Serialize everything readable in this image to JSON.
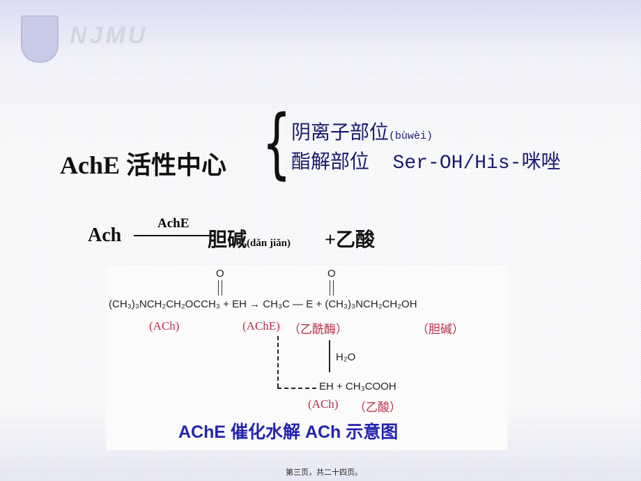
{
  "header": {
    "logo_text": "NJMU"
  },
  "title": "AchE 活性中心",
  "sites": [
    {
      "label": "阴离子部位",
      "note": "(bùwèi)"
    },
    {
      "label": "酯解部位",
      "note": "Ser-OH/His-咪唑"
    }
  ],
  "equation": {
    "reactant": "Ach",
    "enzyme": "AchE",
    "product1": "胆碱",
    "product1_note": "(dǎn jiǎn)",
    "product2": "+乙酸"
  },
  "figure": {
    "oxygen": "O",
    "reactant": "(CH₃)₃NCH₂CH₂OCCH₃",
    "plus": "+",
    "enzyme": "EH",
    "intermediate_left": "CH₃C",
    "intermediate_right": "— E",
    "product": "(CH₃)₃NCH₂CH₂OH",
    "label_ach": "(ACh)",
    "label_ache": "(AChE)",
    "label_acetyl_enzyme": "（乙酰酶）",
    "label_choline": "（胆碱）",
    "water": "H₂O",
    "hydrolysis_products": "EH + CH₃COOH",
    "label_ach2": "(ACh)",
    "label_acetic": "（乙酸）",
    "caption": "AChE 催化水解 ACh 示意图"
  },
  "footer": "第三页，共二十四页。"
}
